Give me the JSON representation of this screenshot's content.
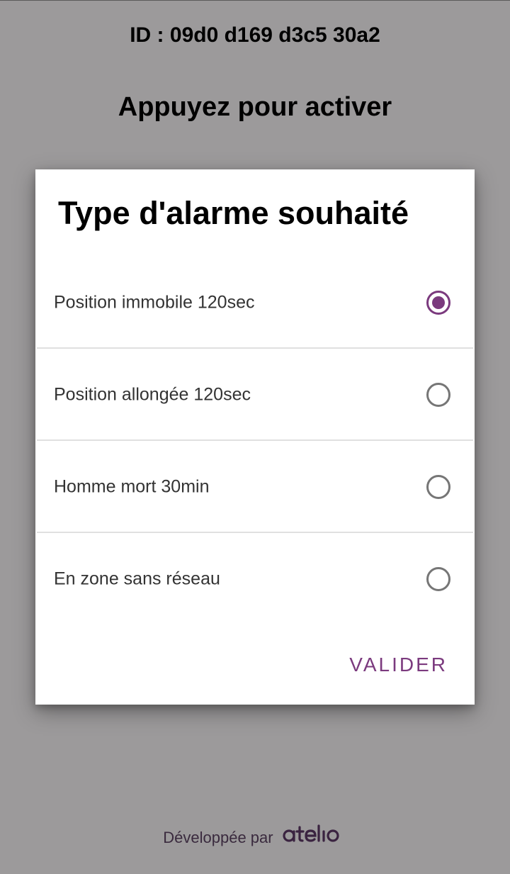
{
  "screen": {
    "device_id": "ID : 09d0 d169 d3c5 30a2",
    "activate_text": "Appuyez pour activer"
  },
  "dialog": {
    "title": "Type d'alarme souhaité",
    "options": [
      {
        "label": "Position immobile 120sec",
        "selected": true
      },
      {
        "label": "Position allongée 120sec",
        "selected": false
      },
      {
        "label": "Homme mort 30min",
        "selected": false
      },
      {
        "label": "En zone sans réseau",
        "selected": false
      }
    ],
    "confirm_label": "VALIDER"
  },
  "footer": {
    "developed_by": "Développée par",
    "brand": "atelio"
  },
  "colors": {
    "accent": "#7b3a7e",
    "scrim": "#9c9a9b",
    "radio_unchecked": "#767676"
  }
}
